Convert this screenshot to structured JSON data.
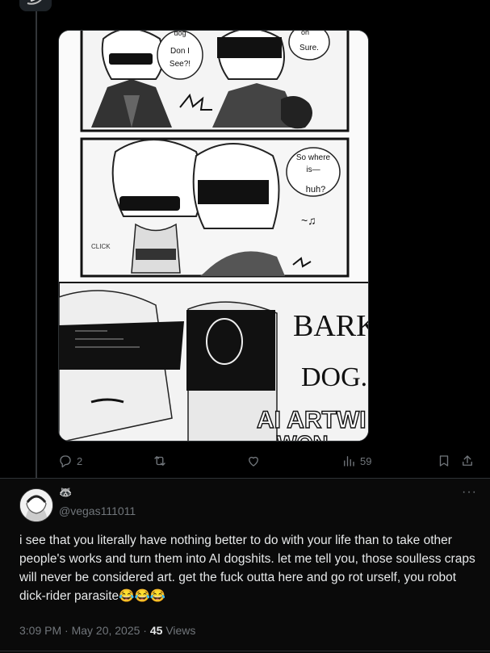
{
  "post": {
    "media": {
      "panel1_bubble_left": [
        "dog",
        "Don I",
        "See?!"
      ],
      "panel1_bubble_right": [
        "oh",
        "Sure."
      ],
      "panel2_bubble": [
        "So where",
        "is—",
        "huh?"
      ],
      "panel2_hum": "~♫",
      "panel2_sfx": "CLICK",
      "panel3_line1": "BARK,",
      "panel3_line2": "DOG.",
      "panel3_watermark": "AI ARTWI",
      "panel3_watermark2": "WON"
    },
    "actions": {
      "replies": "2",
      "views": "59"
    }
  },
  "reply": {
    "name_emoji": "🦝",
    "handle": "@vegas111011",
    "more": "···",
    "text": "i see that you literally have nothing better to do with your life than to take other people's works and turn them into AI dogshits. let me tell you, those soulless craps will never be considered art. get the fuck outta here and go rot urself, you robot dick-rider parasite😂😂😂",
    "time": "3:09 PM · May 20, 2025 · ",
    "views_count": "45",
    "views_label": " Views"
  },
  "colors": {
    "bg": "#000000",
    "muted": "#71767b",
    "text": "#e7e9ea",
    "border": "#2f3336"
  },
  "icons": [
    "reply-icon",
    "repost-icon",
    "like-icon",
    "views-icon",
    "bookmark-icon",
    "share-icon",
    "more-icon"
  ]
}
